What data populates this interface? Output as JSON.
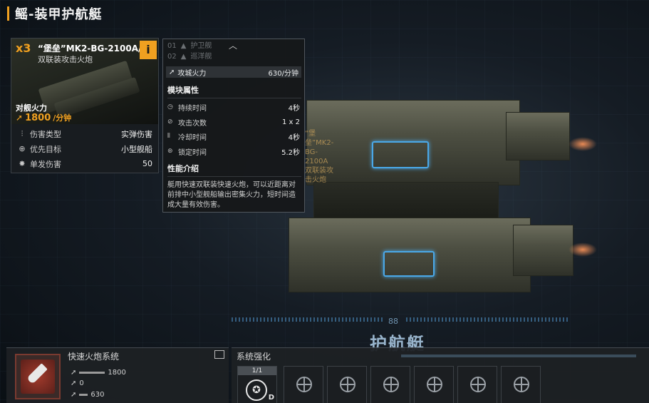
{
  "header": {
    "title": "鳐-装甲护航艇"
  },
  "weapon_card": {
    "quantity": "x3",
    "name": "“堡垒”MK2-BG-2100A/D型",
    "subtitle": "双联装攻击火炮",
    "info_label": "i",
    "firepower_label": "对舰火力",
    "firepower_value": "1800",
    "firepower_unit": "/分钟",
    "stats": [
      {
        "icon": "damage-type-icon",
        "label": "伤害类型",
        "value": "实弹伤害"
      },
      {
        "icon": "target-icon",
        "label": "优先目标",
        "value": "小型舰船"
      },
      {
        "icon": "shot-icon",
        "label": "单发伤害",
        "value": "50"
      }
    ]
  },
  "tooltip": {
    "ship_list": [
      {
        "num": "01",
        "name": "护卫舰"
      },
      {
        "num": "02",
        "name": "巡洋舰"
      }
    ],
    "siege_label": "攻城火力",
    "siege_value": "630/分钟",
    "module_title": "模块属性",
    "module_rows": [
      {
        "icon": "clock-icon",
        "label": "持续时间",
        "value": "4秒"
      },
      {
        "icon": "hits-icon",
        "label": "攻击次数",
        "value": "1 x 2"
      },
      {
        "icon": "cooldown-icon",
        "label": "冷却时间",
        "value": "4秒"
      },
      {
        "icon": "lock-icon",
        "label": "锁定时间",
        "value": "5.2秒"
      }
    ],
    "perf_title": "性能介绍",
    "perf_desc": "艇用快速双联装快速火炮，可以近距离对前排中小型舰船输出密集火力，短时间造成大量有效伤害。"
  },
  "ship": {
    "tag_line1": "“堡垒”MK2-BG-2100A",
    "tag_line2": "双联装攻击火炮",
    "hud_number": "88",
    "class_label": "护航艇"
  },
  "system_panel": {
    "title": "快速火炮系统",
    "rows": [
      {
        "value": "1800"
      },
      {
        "value": "0"
      },
      {
        "value": "630"
      }
    ]
  },
  "enhance_panel": {
    "title": "系统强化",
    "first_slot_count": "1/1",
    "first_slot_grade": "D"
  },
  "colors": {
    "accent": "#f0a020",
    "hud_blue": "#4aa8e8"
  }
}
